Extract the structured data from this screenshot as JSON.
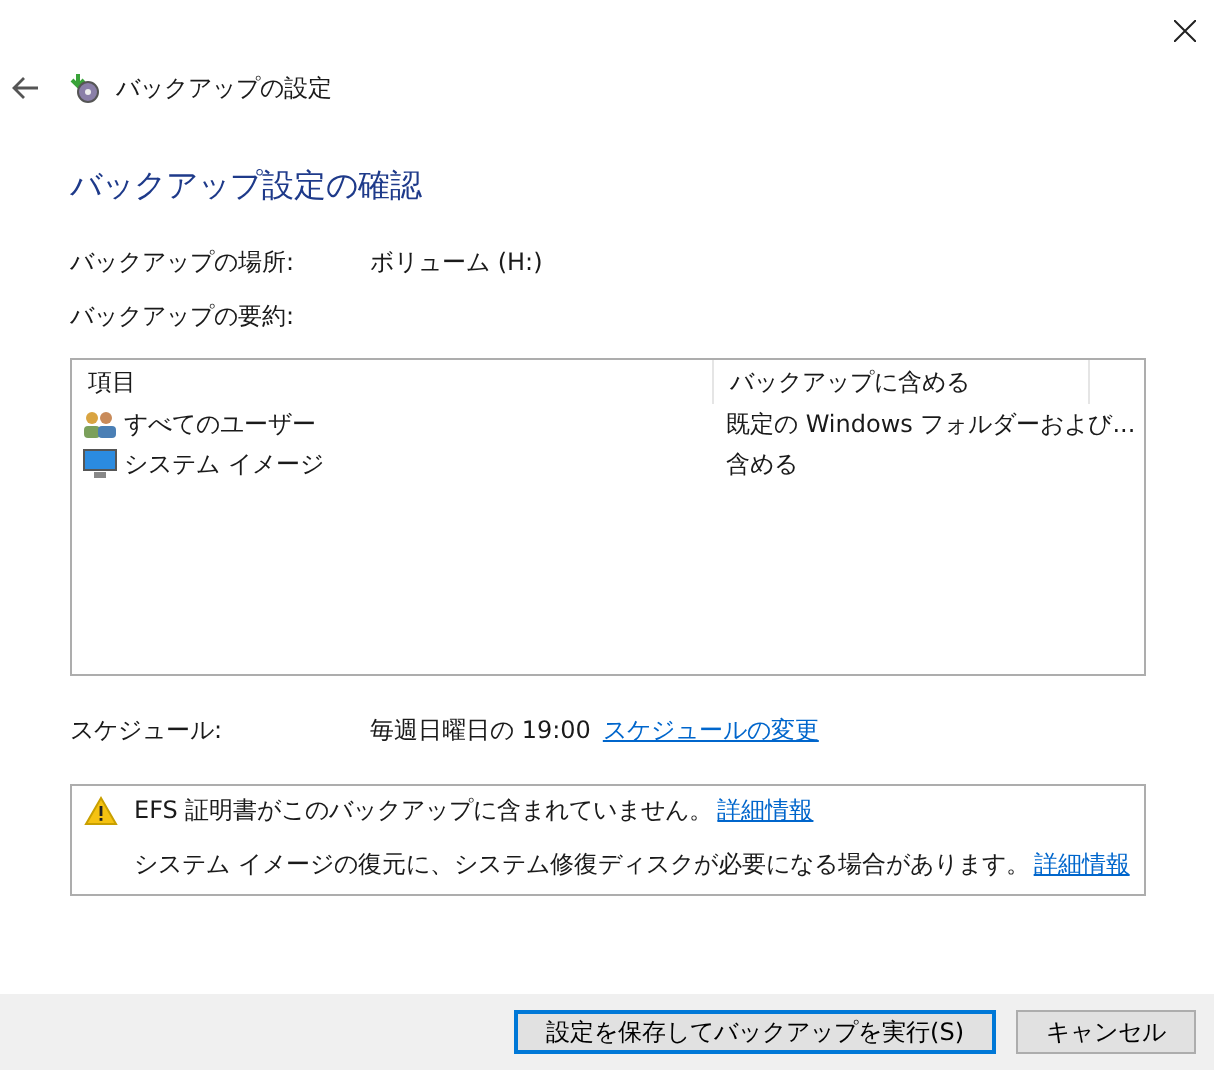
{
  "window": {
    "title": "バックアップの設定"
  },
  "heading": "バックアップ設定の確認",
  "fields": [
    {
      "label": "バックアップの場所:",
      "value": "ボリューム (H:)"
    }
  ],
  "summary_label": "バックアップの要約:",
  "table": {
    "columns": [
      "項目",
      "バックアップに含める"
    ],
    "rows": [
      {
        "kind": "users",
        "item": "すべてのユーザー",
        "included": "既定の Windows フォルダーおよび..."
      },
      {
        "kind": "computer",
        "item": "システム イメージ",
        "included": "含める"
      }
    ]
  },
  "schedule": {
    "label": "スケジュール:",
    "value": "毎週日曜日の 19:00",
    "link": "スケジュールの変更"
  },
  "notices": [
    {
      "kind": "warning",
      "text": "EFS 証明書がこのバックアップに含まれていません。",
      "link": "詳細情報"
    },
    {
      "kind": "plain",
      "text": "システム イメージの復元に、システム修復ディスクが必要になる場合があります。",
      "link": "詳細情報"
    }
  ],
  "buttons": [
    {
      "label": "設定を保存してバックアップを実行(S)",
      "default": true
    },
    {
      "label": "キャンセル",
      "default": false
    }
  ]
}
